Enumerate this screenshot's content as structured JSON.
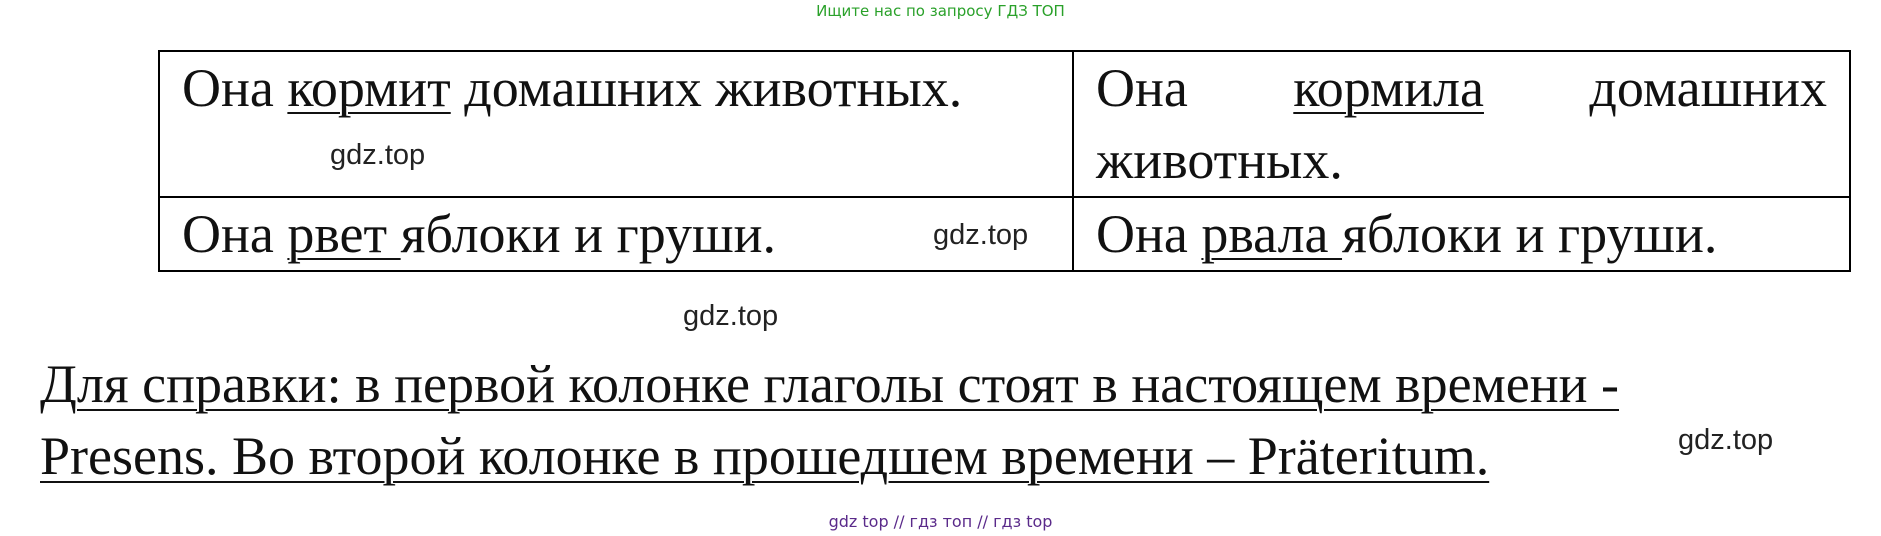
{
  "banner": {
    "text": "Ищите нас по запросу ГДЗ ТОП"
  },
  "table": {
    "rows": [
      {
        "left": {
          "before": "Она ",
          "verb": "кормит",
          "after": " домашних животных."
        },
        "right": {
          "before": "Она ",
          "verb": "кормила",
          "after": " домашних животных."
        }
      },
      {
        "left": {
          "before": "Она ",
          "verb": "рвет ",
          "after": "яблоки и груши."
        },
        "right": {
          "before": "Она ",
          "verb": "рвала ",
          "after": "яблоки и груши."
        }
      }
    ]
  },
  "watermarks": {
    "w1": "gdz.top",
    "w2": "gdz.top",
    "w3": "gdz.top",
    "w4": "gdz.top"
  },
  "note": {
    "line1": "Для справки: в первой колонке глаголы стоят в настоящем времени -",
    "line2": "Presens. Во второй колонке в прошедшем времени – Präteritum."
  },
  "footer": {
    "text": "gdz top  //  гдз топ  //  гдз top"
  }
}
